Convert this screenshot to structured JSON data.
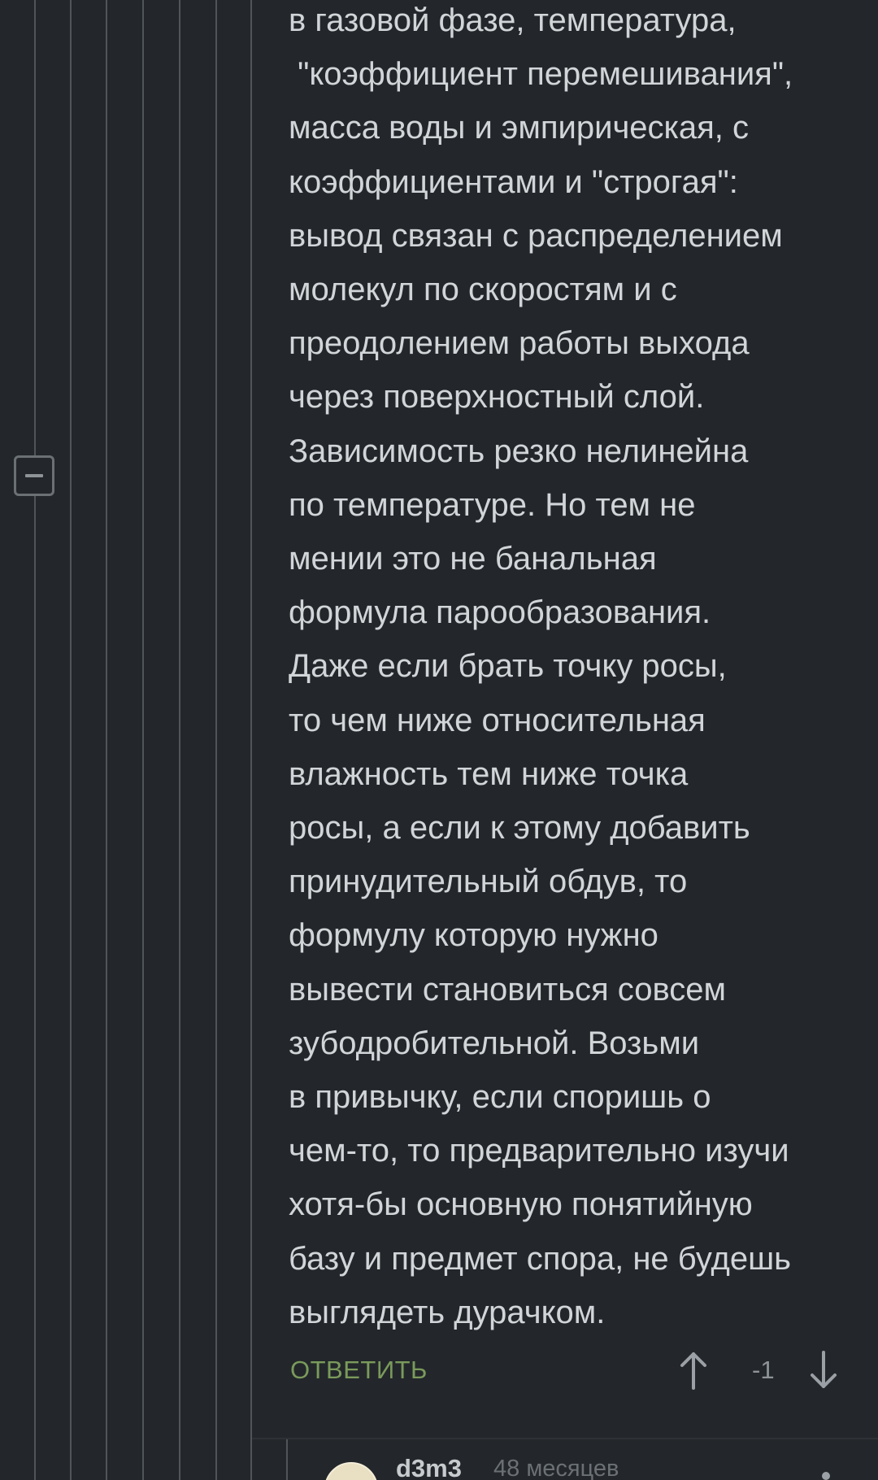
{
  "comment": {
    "lines": [
      "в газовой фазе, температура,",
      " \"коэффициент перемешивания\",",
      "масса воды и эмпирическая, с",
      "коэффициентами и \"строгая\":",
      "вывод связан с распределением",
      "молекул по скоростям и с",
      "преодолением работы выхода",
      "через поверхностный слой.",
      "Зависимость резко нелинейна",
      "по температуре. Но тем не",
      "мении это не банальная",
      "формула парообразования.",
      "Даже если брать точку росы,",
      "то чем ниже относительная",
      "влажность тем ниже точка",
      "росы, а если к этому добавить",
      "принудительный обдув, то",
      "формулу которую нужно",
      "вывести становиться совсем",
      "зубодробительной. Возьми",
      "в привычку, если споришь о",
      "чем-то, то предварительно изучи",
      "хотя-бы основную понятийную",
      "базу и предмет спора, не будешь",
      "выглядеть дурачком."
    ],
    "reply_label": "ОТВЕТИТЬ",
    "rating": "-1"
  },
  "next_comment": {
    "username": "d3m3",
    "timestamp": "48 месяцев"
  },
  "colors": {
    "background": "#23272b",
    "text": "#d2d5d8",
    "reply": "#7a9a5b",
    "thread_line": "#50555a"
  },
  "icons": {
    "collapse": "minus-square-icon",
    "vote_up": "arrow-up-icon",
    "vote_down": "arrow-down-icon",
    "more": "more-dots-icon"
  }
}
